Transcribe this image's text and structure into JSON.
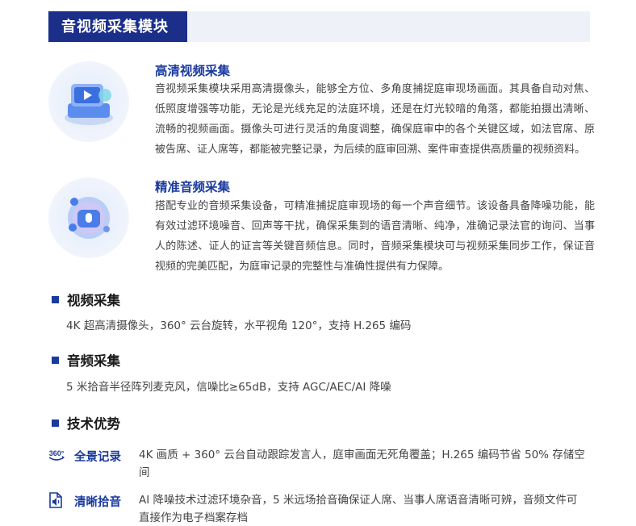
{
  "section_header": {
    "title": "音视频采集模块"
  },
  "features": [
    {
      "title": "高清视频采集",
      "body": "音视频采集模块采用高清摄像头，能够全方位、多角度捕捉庭审现场画面。其具备自动对焦、低照度增强等功能，无论是光线充足的法庭环境，还是在灯光较暗的角落，都能拍摄出清晰、流畅的视频画面。摄像头可进行灵活的角度调整，确保庭审中的各个关键区域，如法官席、原被告席、证人席等，都能被完整记录，为后续的庭审回溯、案件审查提供高质量的视频资料。",
      "icon": "video-camera-icon"
    },
    {
      "title": "精准音频采集",
      "body": "搭配专业的音频采集设备，可精准捕捉庭审现场的每一个声音细节。该设备具备降噪功能，能有效过滤环境噪音、回声等干扰，确保采集到的语音清晰、纯净，准确记录法官的询问、当事人的陈述、证人的证言等关键音频信息。同时，音频采集模块可与视频采集同步工作，保证音视频的完美匹配，为庭审记录的完整性与准确性提供有力保障。",
      "icon": "microphone-icon"
    }
  ],
  "specs": [
    {
      "heading": "视频采集",
      "text": "4K 超高清摄像头，360° 云台旋转，水平视角 120°，支持 H.265 编码"
    },
    {
      "heading": "音频采集",
      "text": "5 米拾音半径阵列麦克风，信噪比≥65dB，支持 AGC/AEC/AI 降噪"
    }
  ],
  "advantages": {
    "heading": "技术优势",
    "items": [
      {
        "icon_text": "360°",
        "icon": "panorama-360-icon",
        "label": "全景记录",
        "text": "4K 画质 + 360° 云台自动跟踪发言人，庭审画面无死角覆盖；H.265 编码节省 50% 存储空间"
      },
      {
        "icon": "audio-file-icon",
        "label": "清晰拾音",
        "text": "AI 降噪技术过滤环境杂音，5 米远场拾音确保证人席、当事人席语音清晰可辨，音频文件可直接作为电子档案存档"
      }
    ]
  },
  "colors": {
    "accent": "#1a3a9e",
    "header_bg": "#1a2e8a",
    "band": "#eef1f8"
  }
}
